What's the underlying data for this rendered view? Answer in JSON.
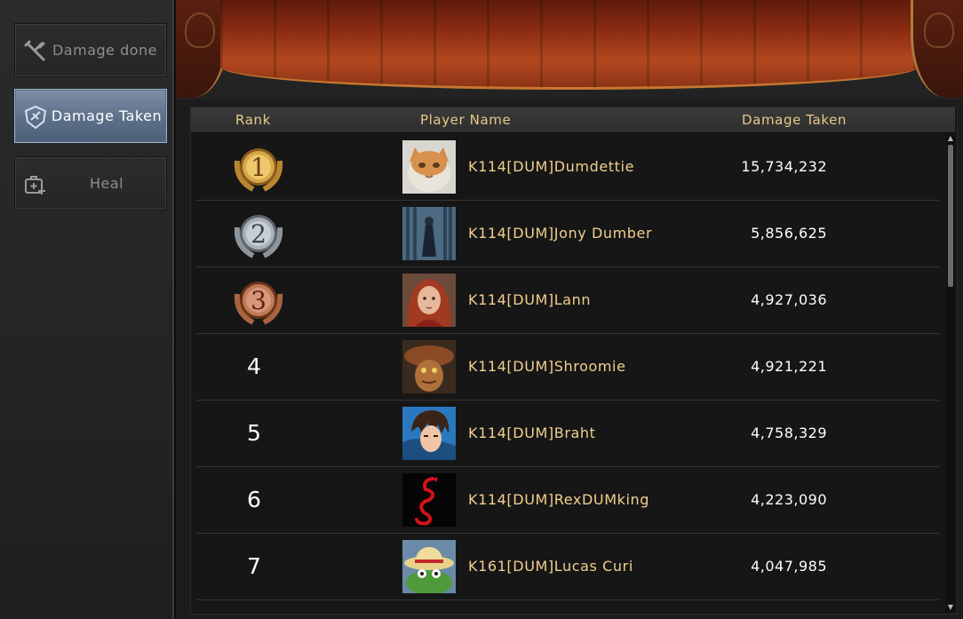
{
  "sidebar": {
    "items": [
      {
        "label": "Damage done",
        "icon": "sword-cross-icon",
        "active": false
      },
      {
        "label": "Damage Taken",
        "icon": "shield-icon",
        "active": true
      },
      {
        "label": "Heal",
        "icon": "medkit-plus-icon",
        "active": false
      }
    ]
  },
  "table": {
    "headers": {
      "rank": "Rank",
      "name": "Player Name",
      "value": "Damage Taken"
    },
    "rows": [
      {
        "rank": "1",
        "medal": "gold",
        "name": "K114[DUM]Dumdettie",
        "value": "15,734,232",
        "avatar": "cat"
      },
      {
        "rank": "2",
        "medal": "silver",
        "name": "K114[DUM]Jony Dumber",
        "value": "5,856,625",
        "avatar": "forest-figure"
      },
      {
        "rank": "3",
        "medal": "bronze",
        "name": "K114[DUM]Lann",
        "value": "4,927,036",
        "avatar": "red-hair-woman"
      },
      {
        "rank": "4",
        "medal": "",
        "name": "K114[DUM]Shroomie",
        "value": "4,921,221",
        "avatar": "mushroom-creature"
      },
      {
        "rank": "5",
        "medal": "",
        "name": "K114[DUM]Braht",
        "value": "4,758,329",
        "avatar": "anime-boy"
      },
      {
        "rank": "6",
        "medal": "",
        "name": "K114[DUM]RexDUMking",
        "value": "4,223,090",
        "avatar": "red-dragon"
      },
      {
        "rank": "7",
        "medal": "",
        "name": "K161[DUM]Lucas Curi",
        "value": "4,047,985",
        "avatar": "frog-hat"
      }
    ]
  },
  "colors": {
    "accent_gold": "#f2cf8d",
    "active_tab": "#6a7d96",
    "curtain": "#9a3a18"
  }
}
